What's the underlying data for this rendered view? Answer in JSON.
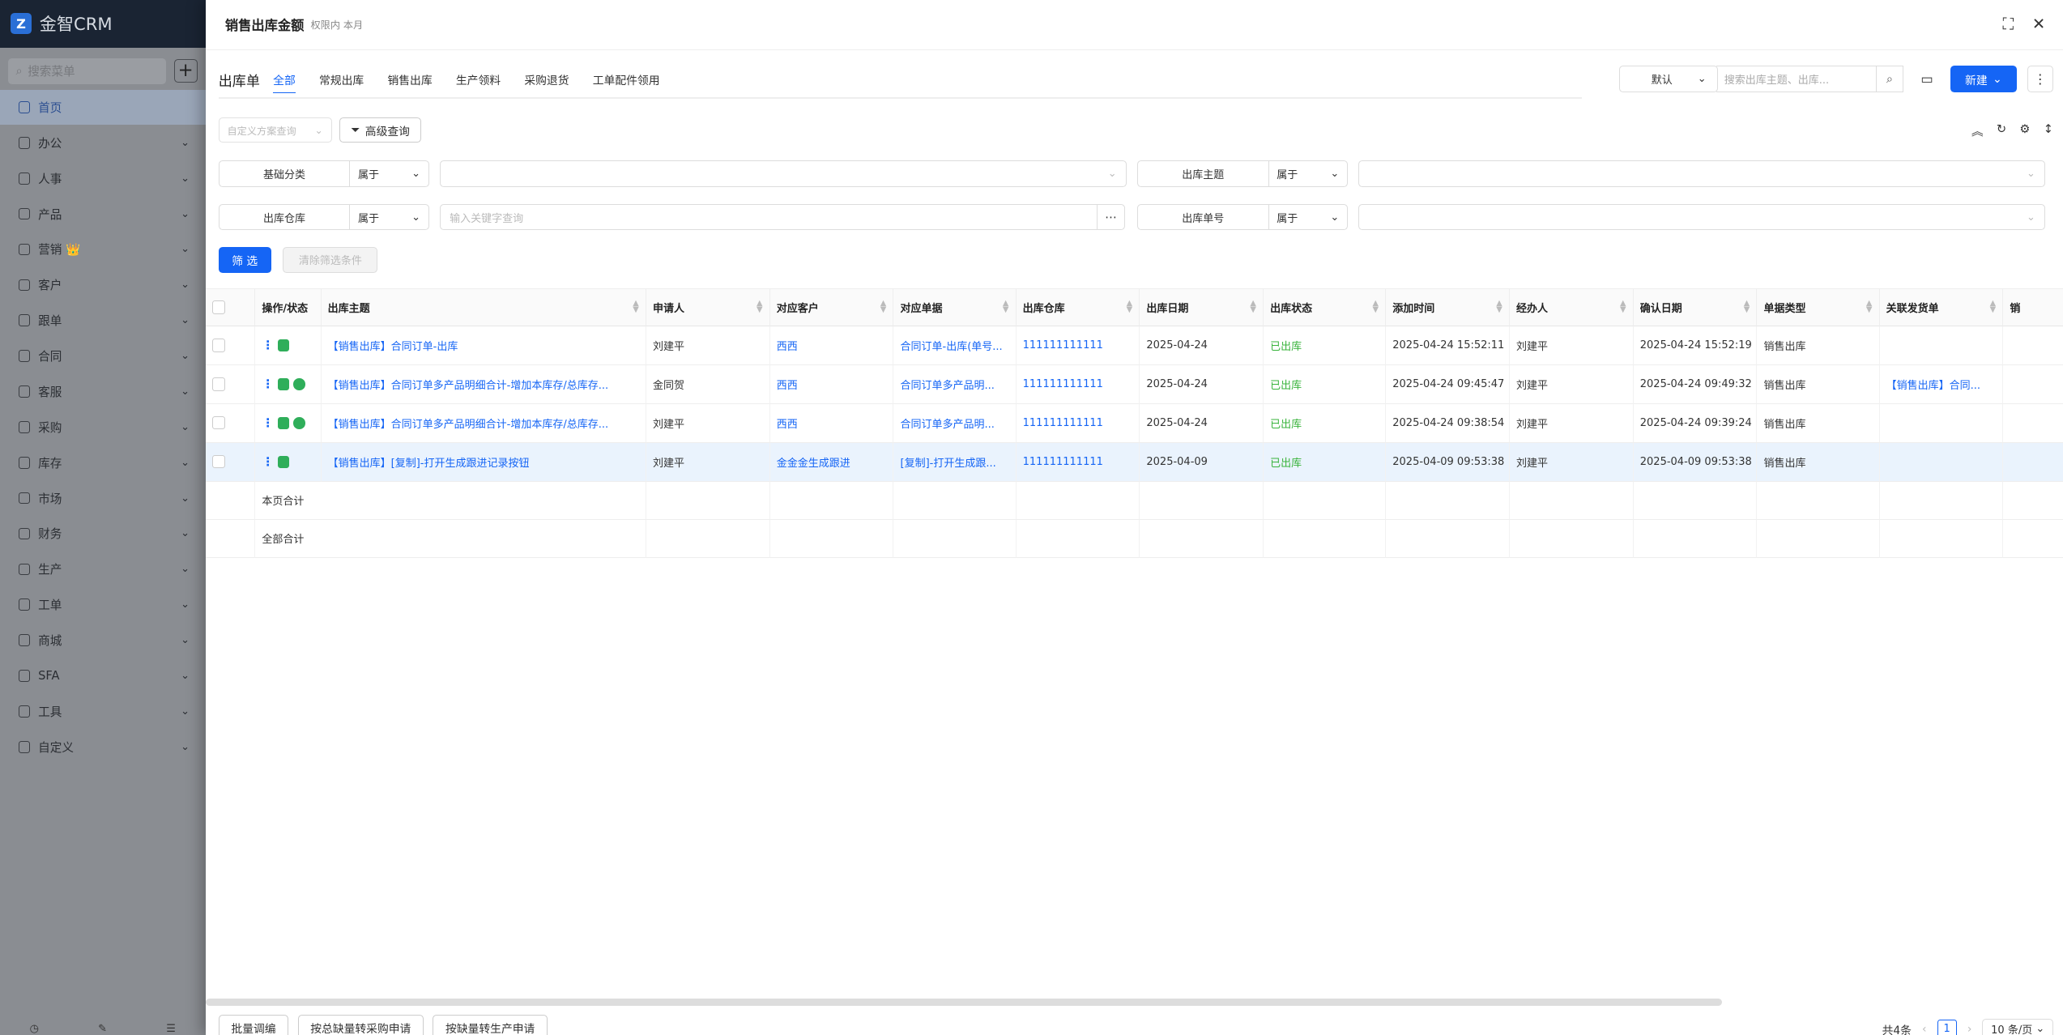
{
  "app": {
    "name": "金智CRM",
    "logo_letter": "Z"
  },
  "sidebar": {
    "search_placeholder": "搜索菜单",
    "items": [
      {
        "label": "首页"
      },
      {
        "label": "办公"
      },
      {
        "label": "人事"
      },
      {
        "label": "产品"
      },
      {
        "label": "营销 👑"
      },
      {
        "label": "客户"
      },
      {
        "label": "跟单"
      },
      {
        "label": "合同"
      },
      {
        "label": "客服"
      },
      {
        "label": "采购"
      },
      {
        "label": "库存"
      },
      {
        "label": "市场"
      },
      {
        "label": "财务"
      },
      {
        "label": "生产"
      },
      {
        "label": "工单"
      },
      {
        "label": "商城"
      },
      {
        "label": "SFA"
      },
      {
        "label": "工具"
      },
      {
        "label": "自定义"
      }
    ]
  },
  "panel": {
    "title": "销售出库金额",
    "subtitle": "权限内 本月",
    "list_label": "出库单",
    "tabs": [
      "全部",
      "常规出库",
      "销售出库",
      "生产领料",
      "采购退货",
      "工单配件领用"
    ],
    "view_select": "默认",
    "search_placeholder": "搜索出库主题、出库...",
    "new_button": "新建",
    "query_placeholder": "自定义方案查询",
    "advanced_query": "高级查询",
    "filters": [
      {
        "label": "基础分类",
        "op": "属于",
        "value": ""
      },
      {
        "label": "出库主题",
        "op": "属于",
        "value": ""
      },
      {
        "label": "出库仓库",
        "op": "属于",
        "value": "输入关键字查询"
      },
      {
        "label": "出库单号",
        "op": "属于",
        "value": ""
      }
    ],
    "filter_button": "筛 选",
    "clear_button": "清除筛选条件"
  },
  "table": {
    "headers": [
      "操作/状态",
      "出库主题",
      "申请人",
      "对应客户",
      "对应单据",
      "出库仓库",
      "出库日期",
      "出库状态",
      "添加时间",
      "经办人",
      "确认日期",
      "单据类型",
      "关联发货单",
      "销"
    ],
    "rows": [
      {
        "subject": "【销售出库】合同订单-出库",
        "applicant": "刘建平",
        "customer": "西西",
        "doc": "合同订单-出库(单号...",
        "warehouse": "111111111111",
        "date": "2025-04-24",
        "status": "已出库",
        "added": "2025-04-24 15:52:11",
        "handler": "刘建平",
        "confirm": "2025-04-24 15:52:19",
        "type": "销售出库",
        "ship": ""
      },
      {
        "subject": "【销售出库】合同订单多产品明细合计-增加本库存/总库存...",
        "applicant": "金同贺",
        "customer": "西西",
        "doc": "合同订单多产品明...",
        "warehouse": "111111111111",
        "date": "2025-04-24",
        "status": "已出库",
        "added": "2025-04-24 09:45:47",
        "handler": "刘建平",
        "confirm": "2025-04-24 09:49:32",
        "type": "销售出库",
        "ship": "【销售出库】合同..."
      },
      {
        "subject": "【销售出库】合同订单多产品明细合计-增加本库存/总库存...",
        "applicant": "刘建平",
        "customer": "西西",
        "doc": "合同订单多产品明...",
        "warehouse": "111111111111",
        "date": "2025-04-24",
        "status": "已出库",
        "added": "2025-04-24 09:38:54",
        "handler": "刘建平",
        "confirm": "2025-04-24 09:39:24",
        "type": "销售出库",
        "ship": ""
      },
      {
        "subject": "【销售出库】[复制]-打开生成跟进记录按钮",
        "applicant": "刘建平",
        "customer": "金金金生成跟进",
        "doc": "[复制]-打开生成跟...",
        "warehouse": "111111111111",
        "date": "2025-04-09",
        "status": "已出库",
        "added": "2025-04-09 09:53:38",
        "handler": "刘建平",
        "confirm": "2025-04-09 09:53:38",
        "type": "销售出库",
        "ship": ""
      }
    ],
    "page_total": "本页合计",
    "all_total": "全部合计"
  },
  "footer": {
    "buttons": [
      "批量调编",
      "按总缺量转采购申请",
      "按缺量转生产申请"
    ],
    "total": "共4条",
    "page": "1",
    "page_size": "10 条/页"
  },
  "colors": {
    "primary": "#1565f5",
    "status_green": "#38b33b",
    "sidebar_dark": "#1a2433"
  }
}
